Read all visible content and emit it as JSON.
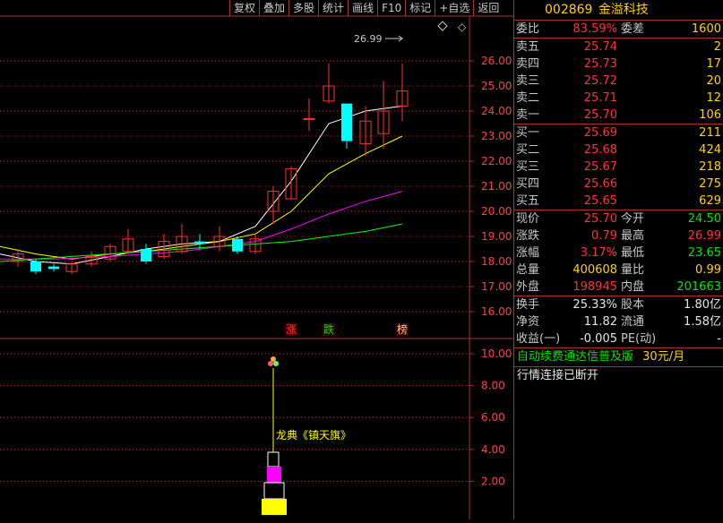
{
  "toolbar": {
    "items": [
      "复权",
      "叠加",
      "多股",
      "统计",
      "画线",
      "F10",
      "标记",
      "+自选",
      "返回"
    ]
  },
  "chart": {
    "peak_label": "26.99",
    "price_axis": [
      "26.00",
      "25.00",
      "24.00",
      "23.00",
      "22.00",
      "21.00",
      "20.00",
      "19.00",
      "18.00",
      "17.00",
      "16.00"
    ],
    "indicator_axis": [
      "10.00",
      "8.00",
      "6.00",
      "4.00",
      "2.00"
    ],
    "markers": [
      {
        "text": "涨",
        "color": "#ff3030"
      },
      {
        "text": "跌",
        "color": "#00e000"
      },
      {
        "text": "榜",
        "color": "#ffcc66"
      }
    ],
    "indicator_label": "龙典《镇天旗》",
    "colors": {
      "up": "#ff3232",
      "down": "#00ffff",
      "ma5": "#ffffff",
      "ma10": "#ffff00",
      "ma20": "#ff00ff",
      "ma60": "#00ff00",
      "grid": "#b03030"
    }
  },
  "panel": {
    "code": "002869",
    "name": "金溢科技",
    "weibi_label": "委比",
    "weibi_value": "83.59%",
    "weicha_label": "委差",
    "weicha_value": "1600",
    "asks": [
      {
        "label": "卖五",
        "price": "25.74",
        "vol": "2"
      },
      {
        "label": "卖四",
        "price": "25.73",
        "vol": "17"
      },
      {
        "label": "卖三",
        "price": "25.72",
        "vol": "20"
      },
      {
        "label": "卖二",
        "price": "25.71",
        "vol": "12"
      },
      {
        "label": "卖一",
        "price": "25.70",
        "vol": "106"
      }
    ],
    "bids": [
      {
        "label": "买一",
        "price": "25.69",
        "vol": "211"
      },
      {
        "label": "买二",
        "price": "25.68",
        "vol": "424"
      },
      {
        "label": "买三",
        "price": "25.67",
        "vol": "218"
      },
      {
        "label": "买四",
        "price": "25.66",
        "vol": "275"
      },
      {
        "label": "买五",
        "price": "25.65",
        "vol": "629"
      }
    ],
    "stats": [
      {
        "l1": "现价",
        "v1": "25.70",
        "c1": "red",
        "l2": "今开",
        "v2": "24.50",
        "c2": "green"
      },
      {
        "l1": "涨跌",
        "v1": "0.79",
        "c1": "red",
        "l2": "最高",
        "v2": "26.99",
        "c2": "red"
      },
      {
        "l1": "涨幅",
        "v1": "3.17%",
        "c1": "red",
        "l2": "最低",
        "v2": "23.65",
        "c2": "green"
      },
      {
        "l1": "总量",
        "v1": "400608",
        "c1": "yellow",
        "l2": "量比",
        "v2": "0.99",
        "c2": "yellow"
      },
      {
        "l1": "外盘",
        "v1": "198945",
        "c1": "red",
        "l2": "内盘",
        "v2": "201663",
        "c2": "green"
      }
    ],
    "fund": [
      {
        "l1": "换手",
        "v1": "25.33%",
        "l2": "股本",
        "v2": "1.80亿"
      },
      {
        "l1": "净资",
        "v1": "11.82",
        "l2": "流通",
        "v2": "1.58亿"
      },
      {
        "l1": "收益(一)",
        "v1": "-0.005",
        "l2": "PE(动)",
        "v2": "-"
      }
    ],
    "promo": "自动续费通达信普及版",
    "promo_price": "30元/月",
    "status": "行情连接已断开"
  }
}
